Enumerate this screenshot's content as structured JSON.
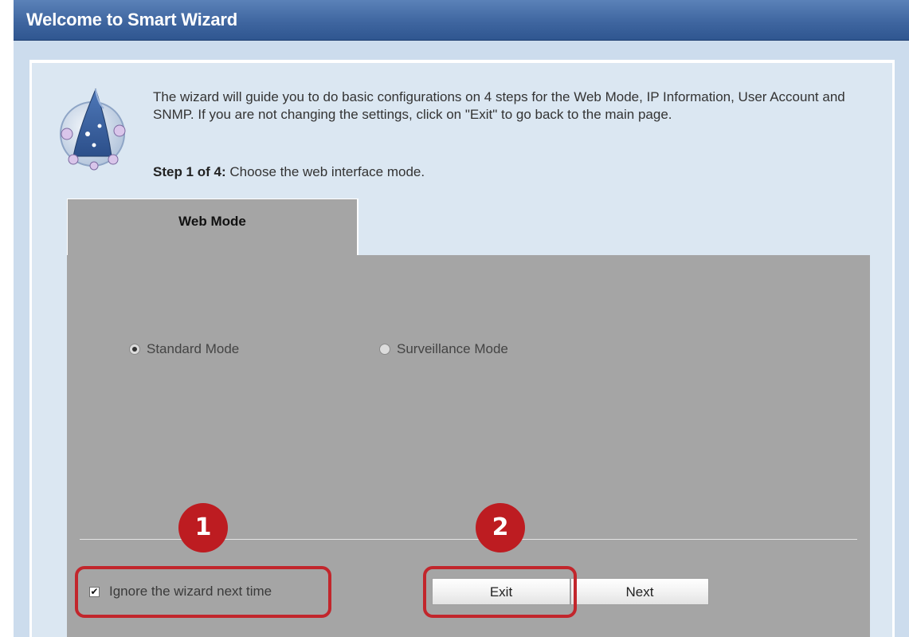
{
  "header": {
    "title": "Welcome to Smart Wizard"
  },
  "intro": {
    "text": "The wizard will guide you to do basic configurations on 4 steps for the Web Mode, IP Information, User Account and SNMP. If you are not changing the settings, click on \"Exit\" to go back to the main page.",
    "step_label": "Step 1 of 4:",
    "step_text": " Choose the web interface mode."
  },
  "tab": {
    "label": "Web Mode"
  },
  "modes": [
    {
      "label": "Standard Mode",
      "selected": true
    },
    {
      "label": "Surveillance Mode",
      "selected": false
    }
  ],
  "ignore_checkbox": {
    "label": "Ignore the wizard next time",
    "checked": true
  },
  "buttons": {
    "exit": "Exit",
    "next": "Next"
  },
  "callouts": {
    "one": "1",
    "two": "2"
  },
  "colors": {
    "title_bar": "#3f66a0",
    "panel_gray": "#a5a5a5",
    "callout_red": "#bd1c21"
  },
  "icons": {
    "wizard": "wizard-hat-icon"
  }
}
